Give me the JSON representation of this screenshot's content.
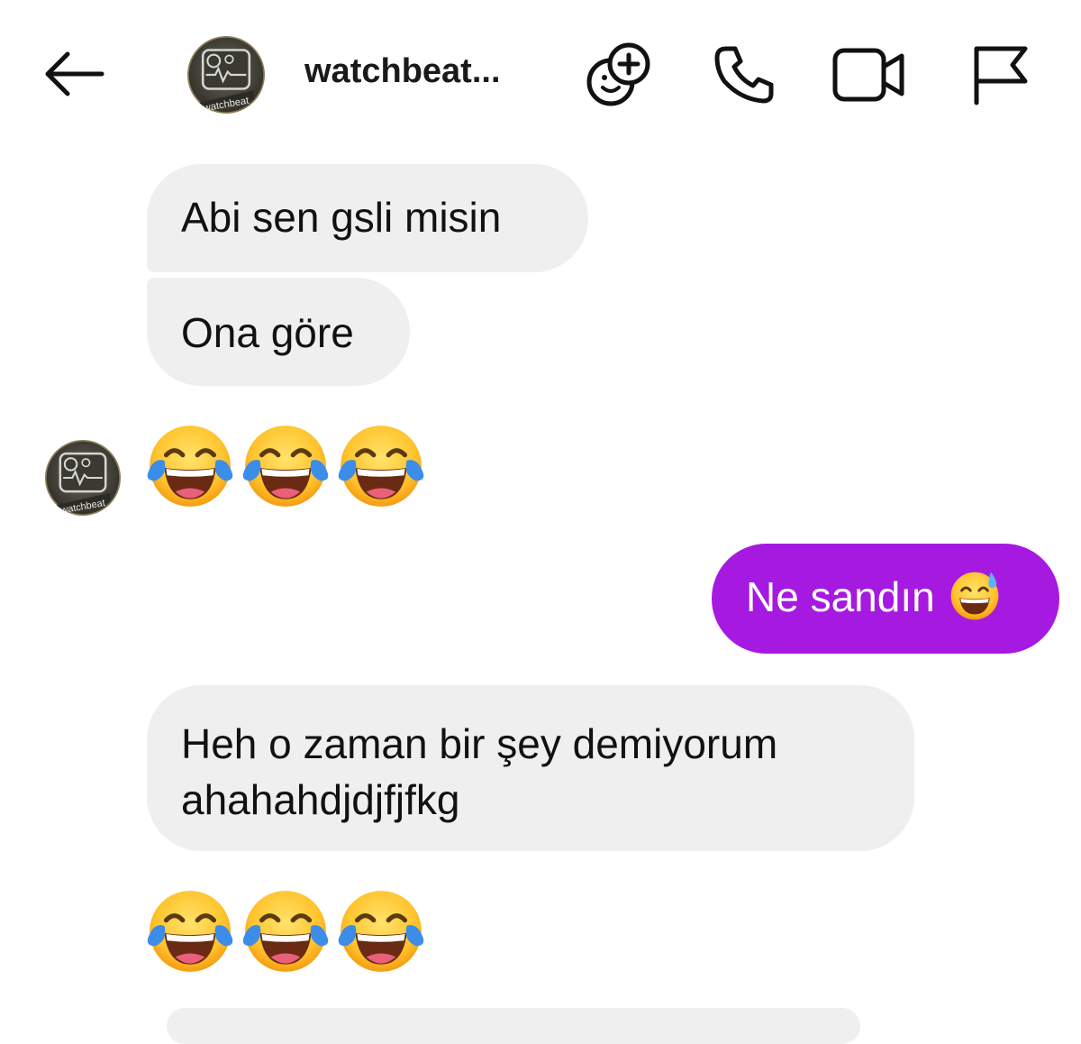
{
  "header": {
    "back_icon": "arrow-left-icon",
    "contact_name": "watchbeat...",
    "avatar_label": "watchbeat",
    "icons": [
      "emoji-add-icon",
      "phone-icon",
      "video-call-icon",
      "flag-icon"
    ]
  },
  "messages": [
    {
      "direction": "incoming",
      "text": "Abi sen gsli misin"
    },
    {
      "direction": "incoming",
      "text": "Ona göre"
    },
    {
      "direction": "incoming",
      "type": "emoji",
      "emojis": [
        "face-with-tears-of-joy",
        "face-with-tears-of-joy",
        "face-with-tears-of-joy"
      ]
    },
    {
      "direction": "outgoing",
      "text": "Ne sandın",
      "emoji": "grinning-face-with-sweat"
    },
    {
      "direction": "incoming",
      "lines": [
        "Heh o zaman bir şey demiyorum",
        "ahahahdjdjfjfkg"
      ]
    },
    {
      "direction": "incoming",
      "type": "emoji",
      "emojis": [
        "face-with-tears-of-joy",
        "face-with-tears-of-joy",
        "face-with-tears-of-joy"
      ]
    }
  ],
  "colors": {
    "outgoing_bubble": "#a619e0",
    "incoming_bubble": "#efefef",
    "text": "#111111"
  }
}
